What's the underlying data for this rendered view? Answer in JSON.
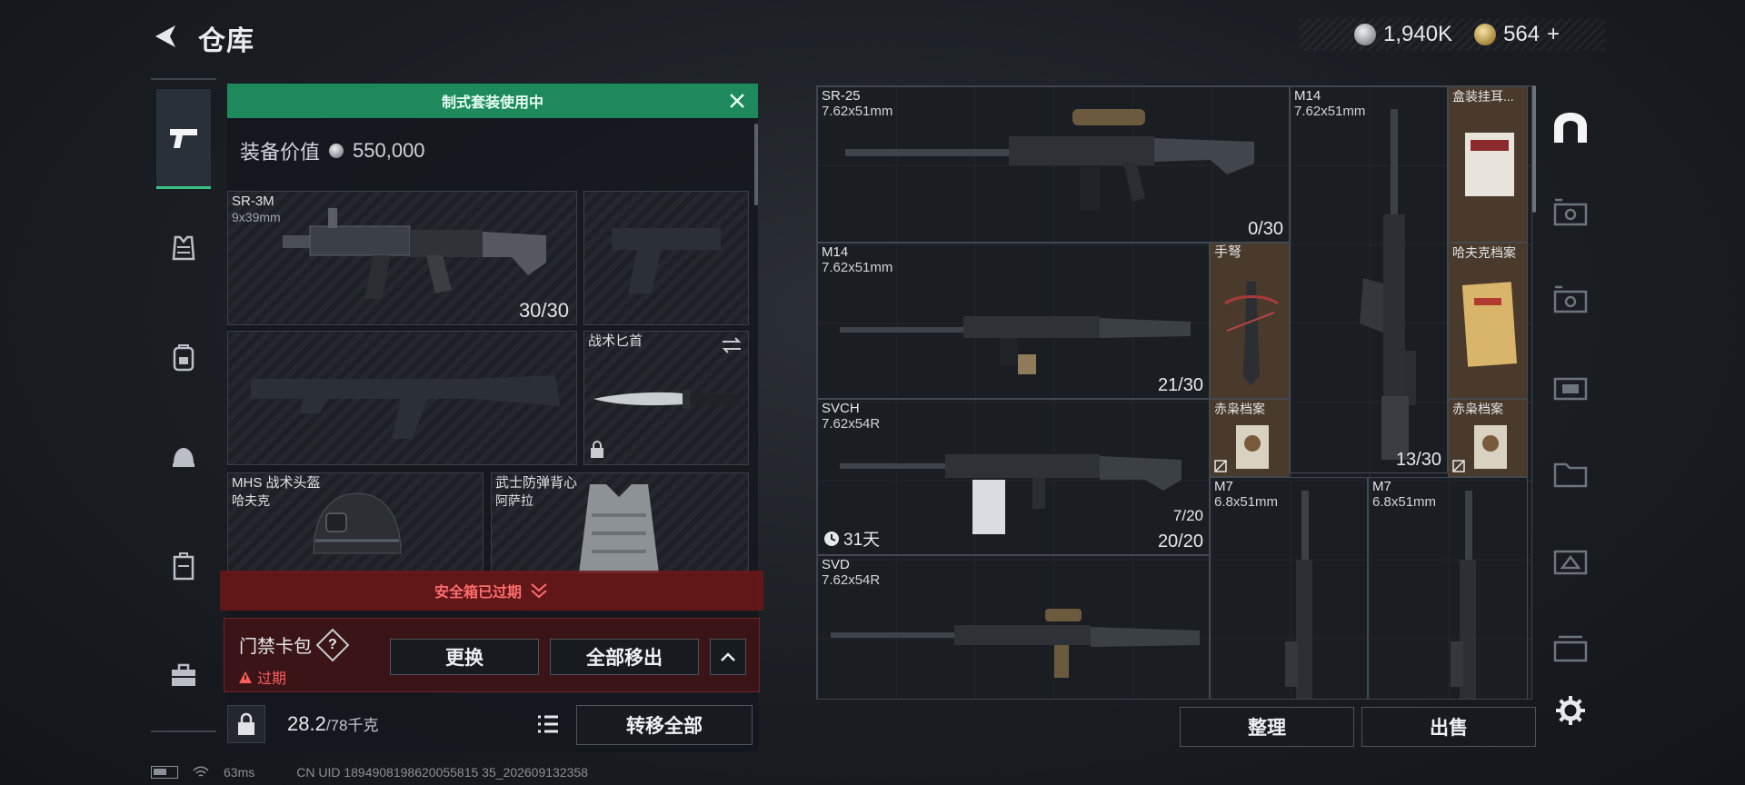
{
  "header": {
    "title": "仓库"
  },
  "currency": {
    "silver": "1,940K",
    "gold": "564",
    "add": "+"
  },
  "loadout": {
    "banner": "制式套装使用中",
    "equip_value_label": "装备价值",
    "equip_value": "550,000",
    "primary": {
      "name": "SR-3M",
      "caliber": "9x39mm",
      "count": "30/30"
    },
    "knife": {
      "name": "战术匕首"
    },
    "helmet": {
      "name": "MHS 战术头盔",
      "sub": "哈夫克"
    },
    "vest": {
      "name": "武士防弹背心",
      "sub": "阿萨拉"
    },
    "expired_notice": "安全箱已过期",
    "keycard": {
      "title": "门禁卡包",
      "help": "?",
      "status": "过期",
      "replace": "更换",
      "move_all": "全部移出"
    },
    "weight": {
      "current": "28.2",
      "max": "/78千克"
    },
    "transfer_all": "转移全部"
  },
  "stash": {
    "items": [
      {
        "name": "SR-25",
        "caliber": "7.62x51mm",
        "count": "0/30"
      },
      {
        "name": "M14",
        "caliber": "7.62x51mm",
        "count": "13/30"
      },
      {
        "name": "盒装挂耳..."
      },
      {
        "name": "M14",
        "caliber": "7.62x51mm",
        "count": "21/30"
      },
      {
        "name": "手弩"
      },
      {
        "name": "哈夫克档案"
      },
      {
        "name": "SVCH",
        "caliber": "7.62x54R",
        "count": "20/20",
        "mag": "7/20",
        "timer": "31天"
      },
      {
        "name": "赤枭档案"
      },
      {
        "name": "赤枭档案"
      },
      {
        "name": "M7",
        "caliber": "6.8x51mm"
      },
      {
        "name": "M7",
        "caliber": "6.8x51mm"
      },
      {
        "name": "SVD",
        "caliber": "7.62x54R"
      }
    ],
    "sort": "整理",
    "sell": "出售"
  },
  "status_bar": {
    "ping": "63ms",
    "uid": "CN UID 1894908198620055815 35_202609132358"
  }
}
